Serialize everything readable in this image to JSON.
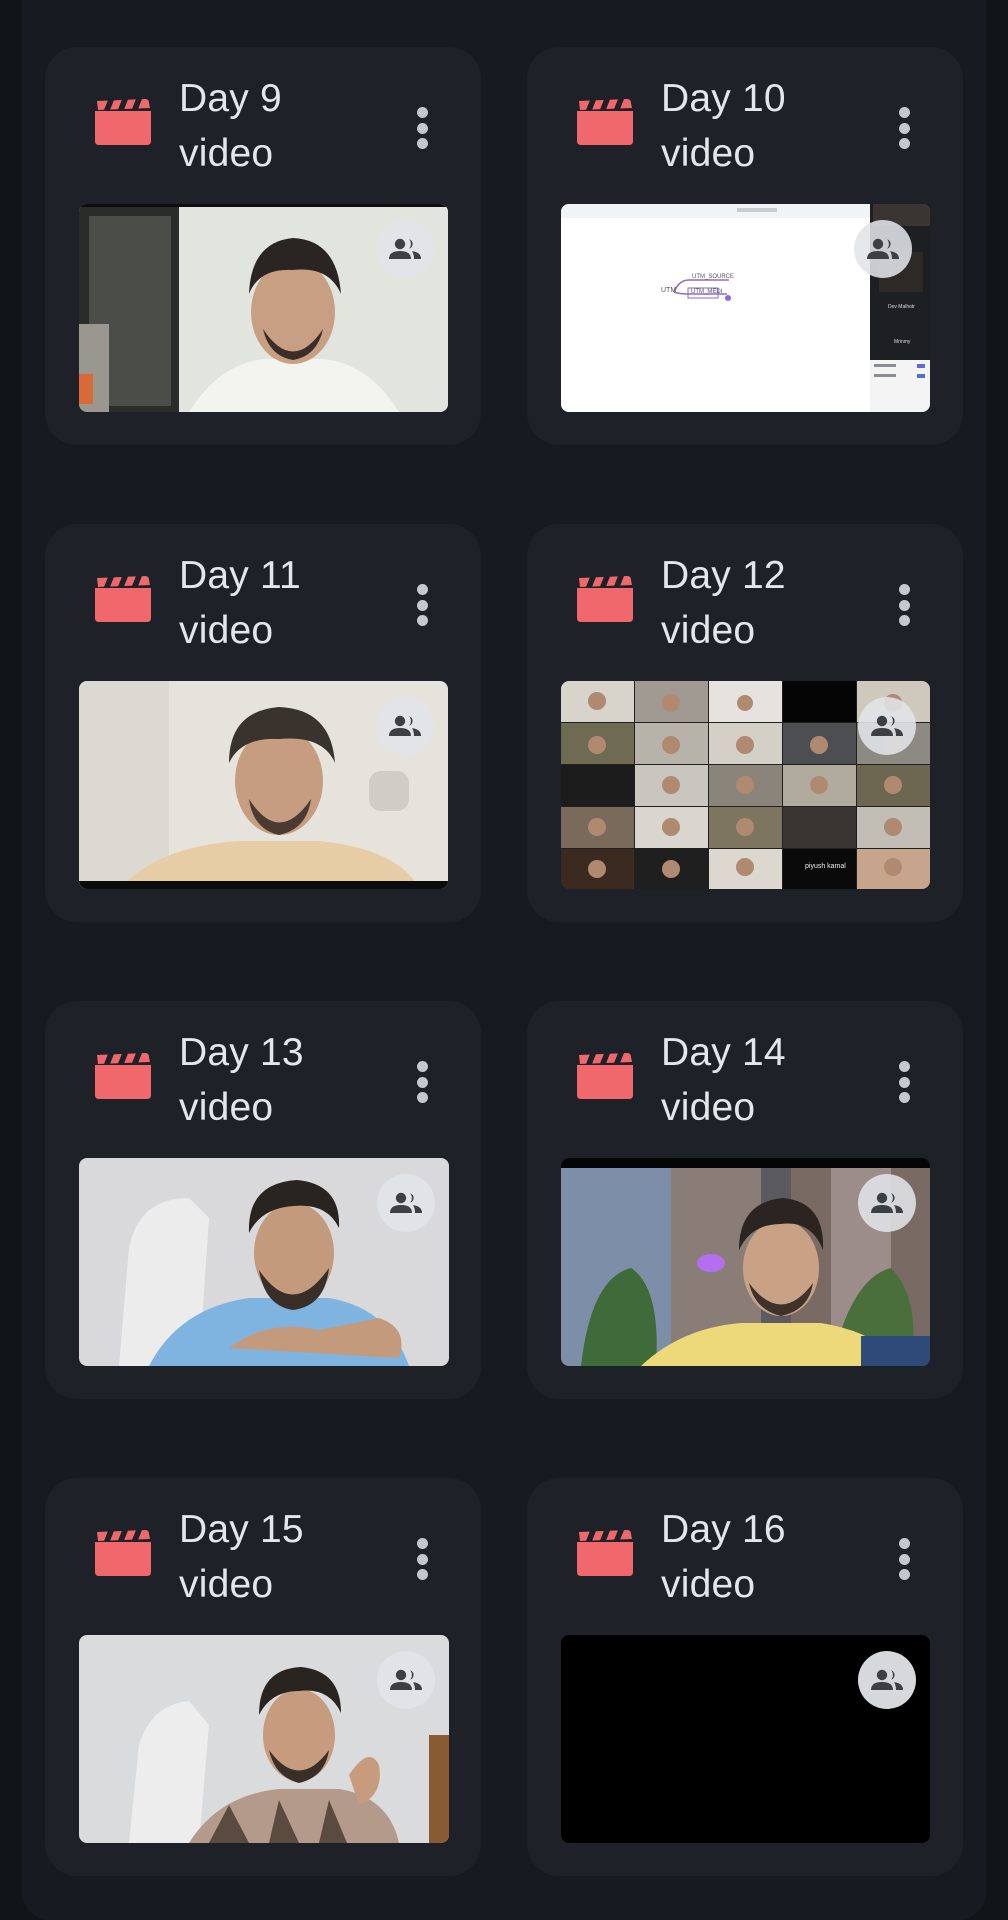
{
  "videos": [
    {
      "line1": "Day 9",
      "line2": "video"
    },
    {
      "line1": "Day 10",
      "line2": "video"
    },
    {
      "line1": "Day 11",
      "line2": "video"
    },
    {
      "line1": "Day 12",
      "line2": "video"
    },
    {
      "line1": "Day 13",
      "line2": "video"
    },
    {
      "line1": "Day 14",
      "line2": "video"
    },
    {
      "line1": "Day 15",
      "line2": "video"
    },
    {
      "line1": "Day 16",
      "line2": "video"
    }
  ],
  "thumb_text": {
    "utm": "UTM",
    "utm_source": "UTM_SOURCE",
    "utm_medium": "UTM_MEDI",
    "side_name_1": "Dev Malhotr",
    "side_name_2": "Mrinmy",
    "participant_name": "piyush kamal"
  },
  "icons": {
    "type": "video-clapperboard",
    "shared": "people",
    "more": "vertical-dots"
  },
  "colors": {
    "background": "#111418",
    "panel": "#171b21",
    "card": "#1e2228",
    "title_text": "#e3e6ea",
    "video_icon": "#f0686b",
    "menu_dots": "#c5c8cd"
  }
}
